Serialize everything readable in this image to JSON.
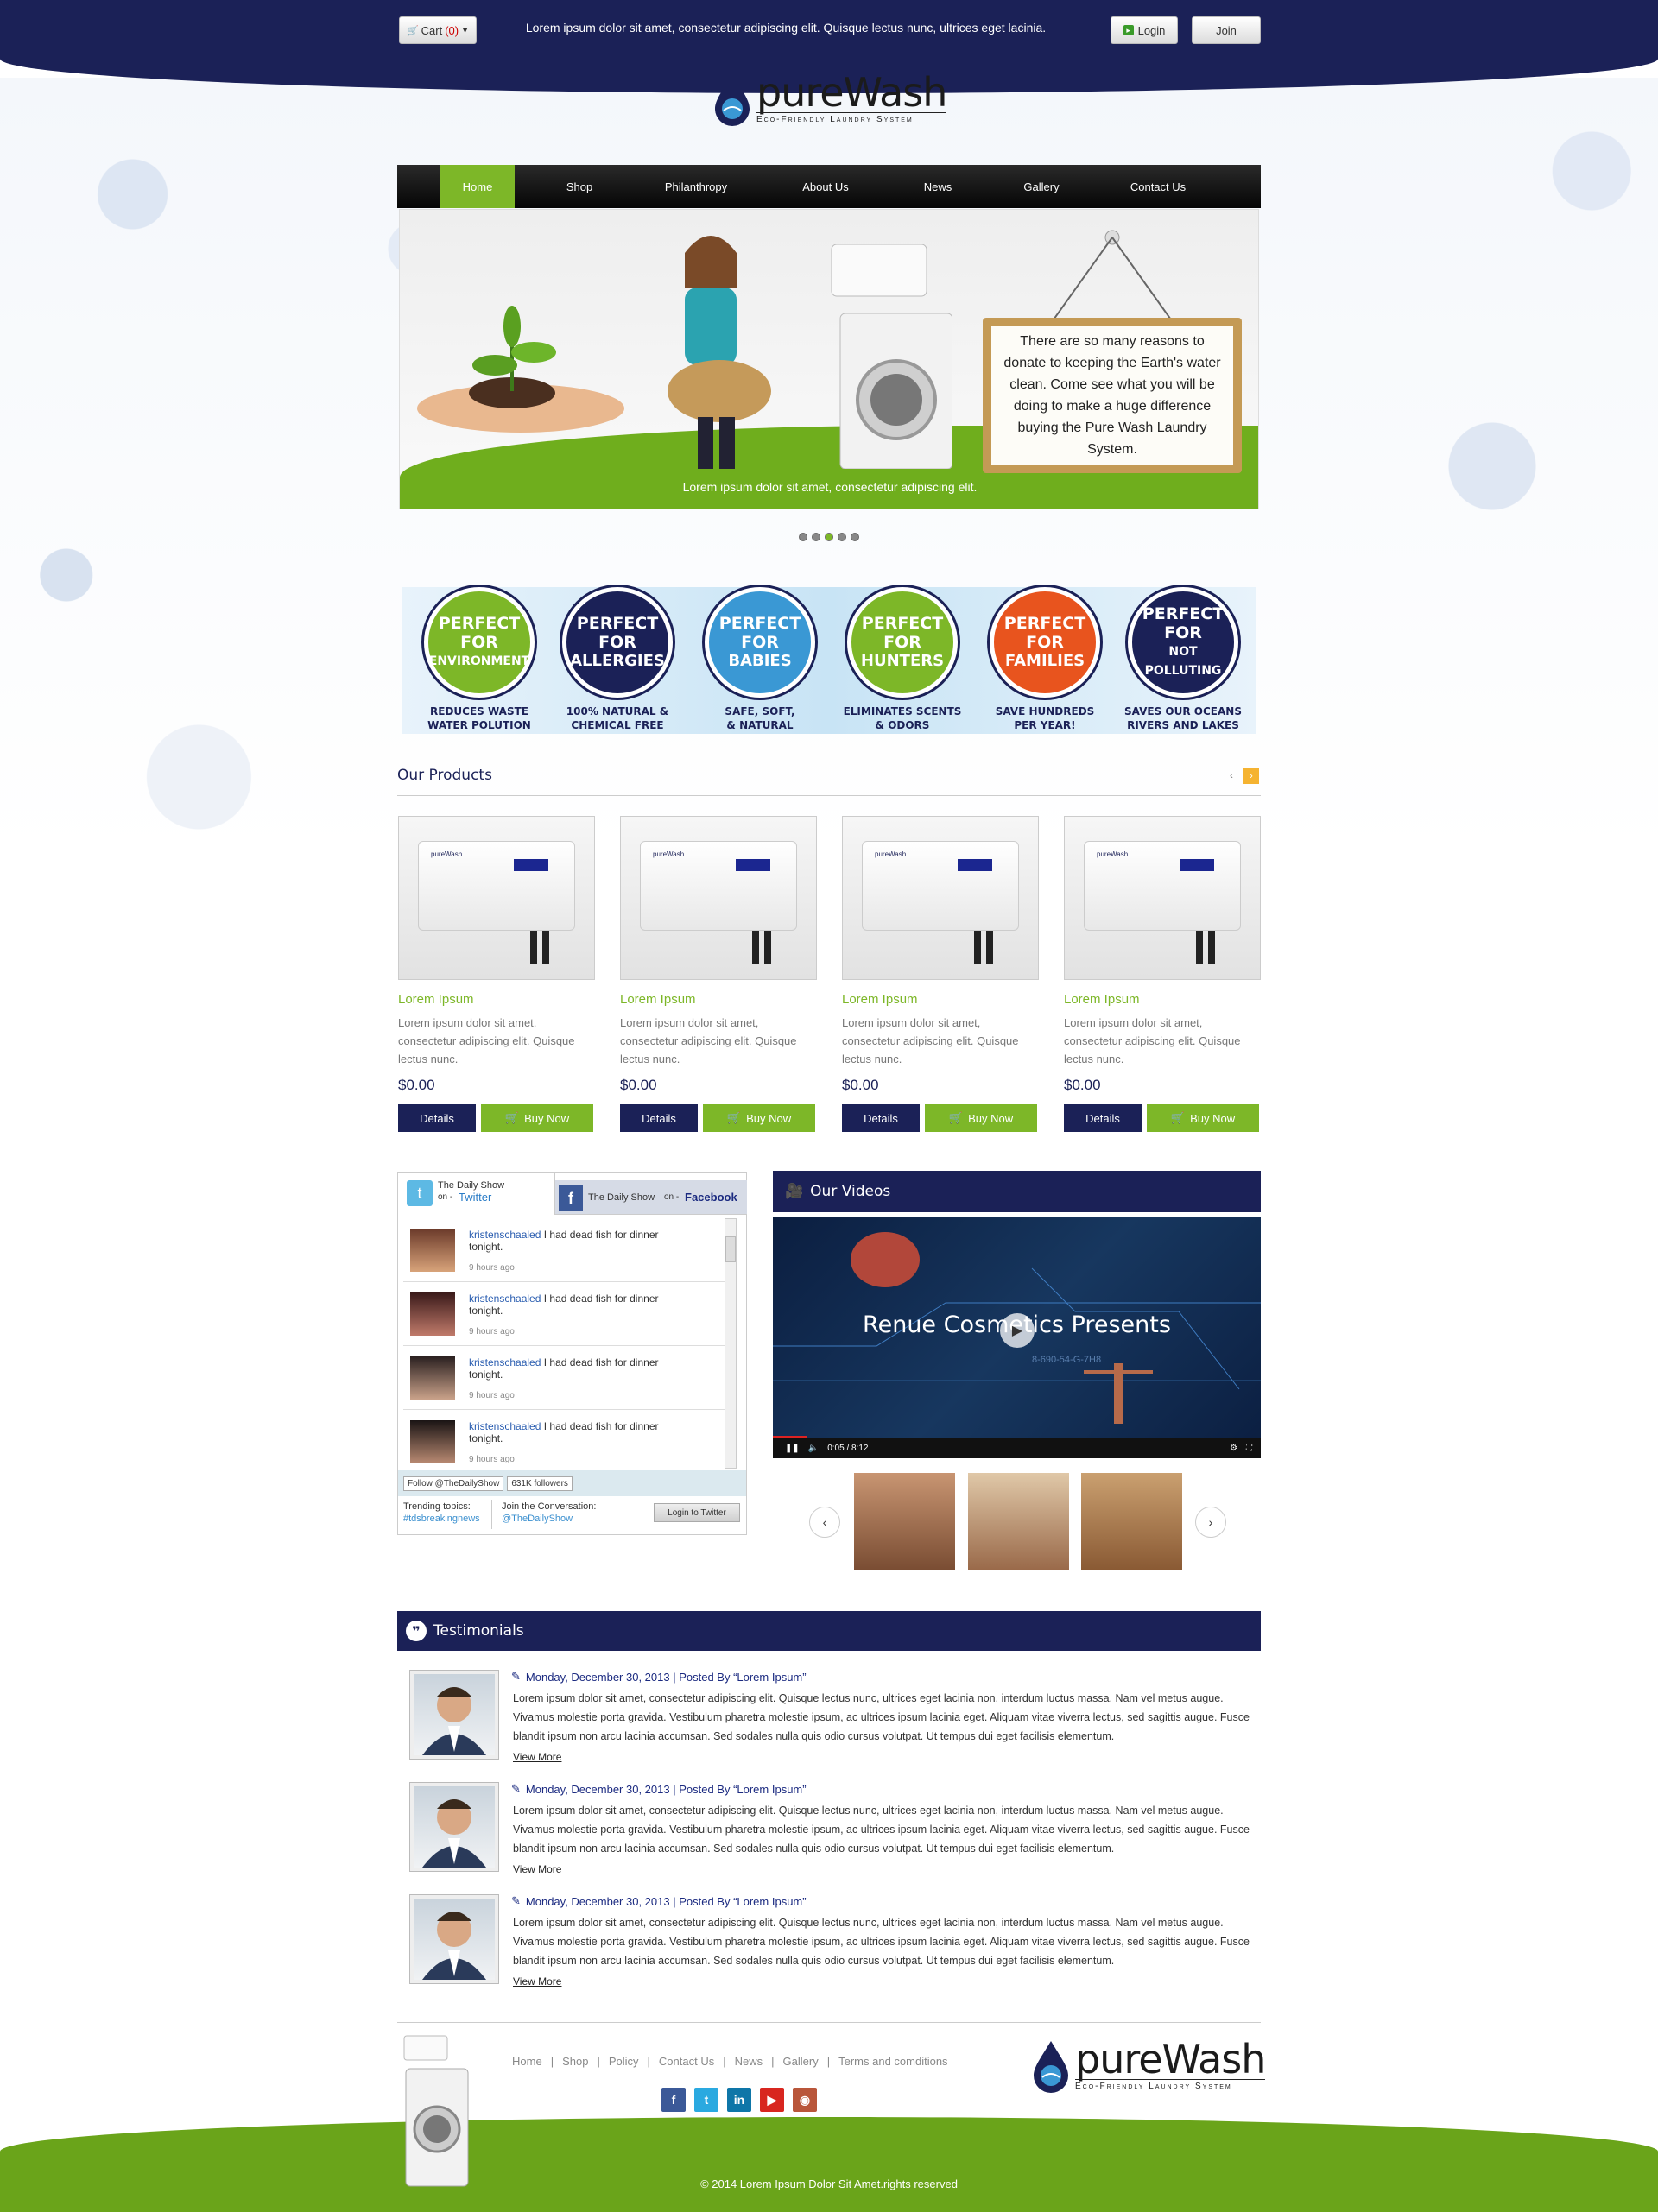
{
  "topbar": {
    "cart_label": "Cart",
    "cart_count": "(0)",
    "message": "Lorem ipsum dolor sit amet, consectetur adipiscing elit. Quisque lectus nunc, ultrices eget lacinia.",
    "login_label": "Login",
    "join_label": "Join"
  },
  "logo": {
    "name": "pureWash",
    "tagline": "Eco-Friendly Laundry System"
  },
  "nav": {
    "items": [
      "Home",
      "Shop",
      "Philanthropy",
      "About Us",
      "News",
      "Gallery",
      "Contact Us"
    ],
    "active": "Home"
  },
  "slider": {
    "sign_text": "There are so many reasons to donate to keeping the Earth's water clean. Come see what you will be doing to make a huge difference buying the Pure Wash Laundry System.",
    "caption": "Lorem ipsum dolor sit amet, consectetur adipiscing elit.",
    "dot_count": 5,
    "active_dot": 3
  },
  "features": [
    {
      "l1": "PERFECT",
      "l2": "FOR",
      "l3": "ENVIRONMENT",
      "cap1": "REDUCES WASTE",
      "cap2": "WATER POLUTION",
      "color": "#7db728"
    },
    {
      "l1": "PERFECT",
      "l2": "FOR",
      "l3": "ALLERGIES",
      "cap1": "100% NATURAL &",
      "cap2": "CHEMICAL FREE",
      "color": "#1b2157"
    },
    {
      "l1": "PERFECT",
      "l2": "FOR",
      "l3": "BABIES",
      "cap1": "SAFE, SOFT,",
      "cap2": "& NATURAL",
      "color": "#3a98d4"
    },
    {
      "l1": "PERFECT",
      "l2": "FOR",
      "l3": "HUNTERS",
      "cap1": "ELIMINATES SCENTS",
      "cap2": "& ODORS",
      "color": "#7db728"
    },
    {
      "l1": "PERFECT",
      "l2": "FOR",
      "l3": "FAMILIES",
      "cap1": "SAVE HUNDREDS",
      "cap2": "PER YEAR!",
      "color": "#e8541e"
    },
    {
      "l1": "PERFECT",
      "l2": "FOR",
      "l3": "NOT POLLUTING",
      "cap1": "SAVES OUR OCEANS",
      "cap2": "RIVERS AND LAKES",
      "color": "#1b2157"
    }
  ],
  "products": {
    "title": "Our Products",
    "items": [
      {
        "name": "Lorem Ipsum",
        "desc": "Lorem ipsum dolor sit amet, consectetur adipiscing elit. Quisque lectus nunc.",
        "price": "$0.00",
        "details": "Details",
        "buy": "Buy Now",
        "brand": "pureWash"
      },
      {
        "name": "Lorem Ipsum",
        "desc": "Lorem ipsum dolor sit amet, consectetur adipiscing elit. Quisque lectus nunc.",
        "price": "$0.00",
        "details": "Details",
        "buy": "Buy Now",
        "brand": "pureWash"
      },
      {
        "name": "Lorem Ipsum",
        "desc": "Lorem ipsum dolor sit amet, consectetur adipiscing elit. Quisque lectus nunc.",
        "price": "$0.00",
        "details": "Details",
        "buy": "Buy Now",
        "brand": "pureWash"
      },
      {
        "name": "Lorem Ipsum",
        "desc": "Lorem ipsum dolor sit amet, consectetur adipiscing elit. Quisque lectus nunc.",
        "price": "$0.00",
        "details": "Details",
        "buy": "Buy Now",
        "brand": "pureWash"
      }
    ]
  },
  "social": {
    "twitter_tab": {
      "show": "The Daily Show",
      "on": "on -",
      "network": "Twitter"
    },
    "facebook_tab": {
      "show": "The Daily Show",
      "on": "on -",
      "network": "Facebook"
    },
    "tweets": [
      {
        "user": "kristenschaaled",
        "text": "I had dead fish for dinner tonight.",
        "time": "9 hours ago"
      },
      {
        "user": "kristenschaaled",
        "text": "I had dead fish for dinner tonight.",
        "time": "9 hours ago"
      },
      {
        "user": "kristenschaaled",
        "text": "I had dead fish for dinner tonight.",
        "time": "9 hours ago"
      },
      {
        "user": "kristenschaaled",
        "text": "I had dead fish for dinner tonight.",
        "time": "9 hours ago"
      }
    ],
    "follow_label": "Follow @TheDailyShow",
    "followers": "631K followers",
    "trending_label": "Trending topics:",
    "trending_tag": "#tdsbreakingnews",
    "join_label": "Join the Conversation:",
    "join_handle": "@TheDailyShow",
    "login_button": "Login to Twitter"
  },
  "videos": {
    "title": "Our Videos",
    "video_title": "Renue Cosmetics Presents",
    "overlay_code": "8-690-54-G-7H8",
    "time": "0:05 / 8:12"
  },
  "testimonials": {
    "title": "Testimonials",
    "items": [
      {
        "meta": "Monday, December 30, 2013 | Posted By “Lorem Ipsum”",
        "body": "Lorem ipsum dolor sit amet, consectetur adipiscing elit. Quisque lectus nunc, ultrices eget lacinia non, interdum luctus massa. Nam vel metus augue. Vivamus molestie porta gravida. Vestibulum pharetra molestie ipsum, ac ultrices ipsum lacinia eget. Aliquam vitae viverra lectus, sed sagittis augue. Fusce blandit ipsum non arcu lacinia accumsan. Sed sodales nulla quis odio cursus volutpat. Ut tempus dui eget facilisis elementum.",
        "more": "View More"
      },
      {
        "meta": "Monday, December 30, 2013 | Posted By “Lorem Ipsum”",
        "body": "Lorem ipsum dolor sit amet, consectetur adipiscing elit. Quisque lectus nunc, ultrices eget lacinia non, interdum luctus massa. Nam vel metus augue. Vivamus molestie porta gravida. Vestibulum pharetra molestie ipsum, ac ultrices ipsum lacinia eget. Aliquam vitae viverra lectus, sed sagittis augue. Fusce blandit ipsum non arcu lacinia accumsan. Sed sodales nulla quis odio cursus volutpat. Ut tempus dui eget facilisis elementum.",
        "more": "View More"
      },
      {
        "meta": "Monday, December 30, 2013 | Posted By “Lorem Ipsum”",
        "body": "Lorem ipsum dolor sit amet, consectetur adipiscing elit. Quisque lectus nunc, ultrices eget lacinia non, interdum luctus massa. Nam vel metus augue. Vivamus molestie porta gravida. Vestibulum pharetra molestie ipsum, ac ultrices ipsum lacinia eget. Aliquam vitae viverra lectus, sed sagittis augue. Fusce blandit ipsum non arcu lacinia accumsan. Sed sodales nulla quis odio cursus volutpat. Ut tempus dui eget facilisis elementum.",
        "more": "View More"
      }
    ]
  },
  "footer": {
    "links": [
      "Home",
      "Shop",
      "Policy",
      "Contact Us",
      "News",
      "Gallery",
      "Terms and comditions"
    ],
    "socials": [
      {
        "icon": "facebook-icon",
        "glyph": "f",
        "color": "#3b5998"
      },
      {
        "icon": "twitter-icon",
        "glyph": "t",
        "color": "#2aa9e0"
      },
      {
        "icon": "linkedin-icon",
        "glyph": "in",
        "color": "#0e76a8"
      },
      {
        "icon": "youtube-icon",
        "glyph": "▶",
        "color": "#d8261f"
      },
      {
        "icon": "instagram-icon",
        "glyph": "◉",
        "color": "#b9563a"
      }
    ],
    "copyright": "© 2014 Lorem Ipsum Dolor Sit Amet.rights reserved"
  },
  "colors": {
    "navy": "#1b2157",
    "green": "#7db728",
    "orange": "#e8541e",
    "blue": "#3a98d4"
  }
}
